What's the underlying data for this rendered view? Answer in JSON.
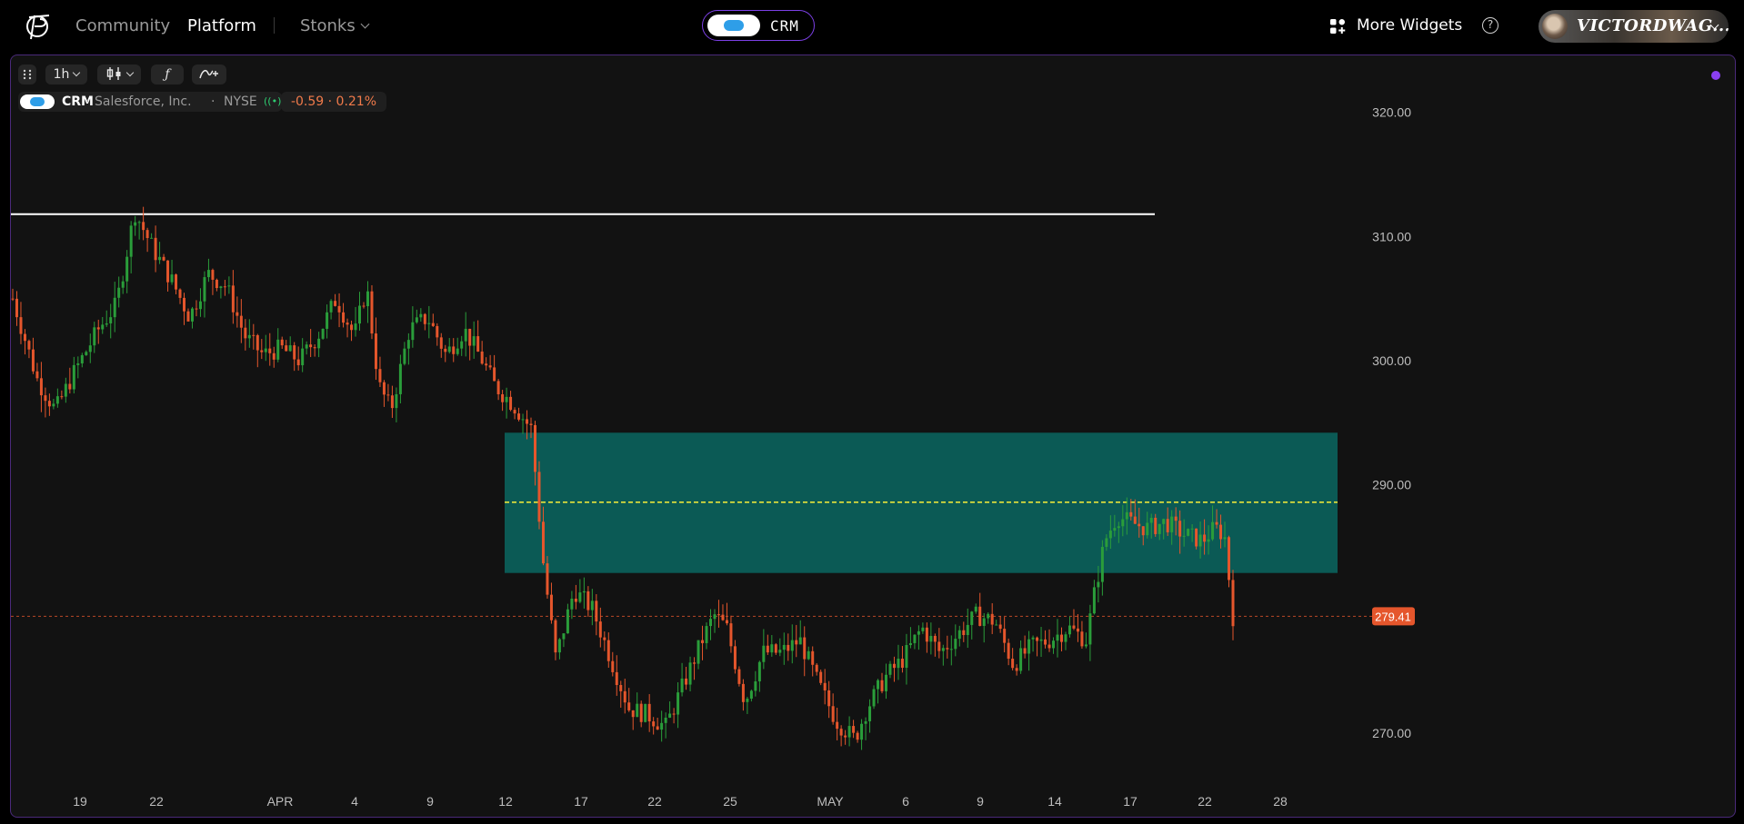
{
  "nav": {
    "community": "Community",
    "platform": "Platform",
    "stonks": "Stonks",
    "ticker": "CRM",
    "more_widgets": "More Widgets",
    "help": "?",
    "username": "VICTORDWAG..."
  },
  "toolbar": {
    "interval": "1h",
    "chart_type": "candles",
    "indicators": "f",
    "drawing": "draw"
  },
  "legend": {
    "symbol": "CRM",
    "name": "Salesforce, Inc.",
    "exchange": "NYSE",
    "change": "-0.59 · 0.21%",
    "sep": "·"
  },
  "colors": {
    "up": "#2a9d3a",
    "down": "#e5562c",
    "zone": "#0b5a55",
    "accent": "#7b3fe4",
    "last_price": "#e5562c"
  },
  "chart_data": {
    "type": "candlestick",
    "interval": "1h",
    "ylim": [
      264,
      324
    ],
    "y_ticks": [
      "320.00",
      "310.00",
      "300.00",
      "290.00",
      "270.00"
    ],
    "x_ticks": [
      "19",
      "22",
      "APR",
      "4",
      "9",
      "12",
      "17",
      "22",
      "25",
      "MAY",
      "6",
      "9",
      "14",
      "17",
      "22",
      "28"
    ],
    "last_price": "279.41",
    "last_price_value": 279.41,
    "resistance_line": 311.8,
    "zone": {
      "top": 294.2,
      "bottom": 282.9
    },
    "zone_midline": 288.6,
    "path_points": [
      [
        0,
        305.0
      ],
      [
        0.02,
        298.5
      ],
      [
        0.035,
        296.0
      ],
      [
        0.05,
        299.0
      ],
      [
        0.07,
        302.5
      ],
      [
        0.085,
        304.5
      ],
      [
        0.1,
        312.0
      ],
      [
        0.115,
        309.0
      ],
      [
        0.13,
        306.5
      ],
      [
        0.145,
        303.5
      ],
      [
        0.16,
        307.0
      ],
      [
        0.175,
        306.0
      ],
      [
        0.19,
        302.0
      ],
      [
        0.205,
        300.5
      ],
      [
        0.22,
        301.0
      ],
      [
        0.235,
        300.0
      ],
      [
        0.25,
        302.0
      ],
      [
        0.265,
        305.0
      ],
      [
        0.28,
        302.0
      ],
      [
        0.29,
        306.0
      ],
      [
        0.3,
        298.0
      ],
      [
        0.31,
        296.0
      ],
      [
        0.325,
        302.5
      ],
      [
        0.34,
        303.5
      ],
      [
        0.355,
        300.5
      ],
      [
        0.37,
        302.5
      ],
      [
        0.385,
        300.0
      ],
      [
        0.395,
        298.0
      ],
      [
        0.41,
        296.5
      ],
      [
        0.425,
        294.5
      ],
      [
        0.435,
        283.5
      ],
      [
        0.445,
        276.0
      ],
      [
        0.46,
        281.5
      ],
      [
        0.475,
        280.0
      ],
      [
        0.49,
        276.0
      ],
      [
        0.505,
        272.0
      ],
      [
        0.52,
        271.5
      ],
      [
        0.535,
        270.5
      ],
      [
        0.55,
        274.0
      ],
      [
        0.565,
        277.5
      ],
      [
        0.575,
        279.5
      ],
      [
        0.585,
        278.5
      ],
      [
        0.6,
        272.5
      ],
      [
        0.615,
        276.5
      ],
      [
        0.63,
        276.5
      ],
      [
        0.645,
        277.5
      ],
      [
        0.66,
        274.0
      ],
      [
        0.675,
        271.0
      ],
      [
        0.69,
        269.5
      ],
      [
        0.7,
        272.0
      ],
      [
        0.715,
        274.5
      ],
      [
        0.73,
        276.0
      ],
      [
        0.745,
        278.5
      ],
      [
        0.76,
        276.5
      ],
      [
        0.775,
        278.0
      ],
      [
        0.79,
        279.5
      ],
      [
        0.805,
        279.0
      ],
      [
        0.82,
        275.5
      ],
      [
        0.835,
        277.0
      ],
      [
        0.85,
        277.5
      ],
      [
        0.865,
        278.5
      ],
      [
        0.88,
        277.5
      ],
      [
        0.885,
        280.5
      ],
      [
        0.895,
        285.5
      ],
      [
        0.905,
        287.5
      ],
      [
        0.915,
        287.0
      ],
      [
        0.93,
        286.5
      ],
      [
        0.945,
        287.0
      ],
      [
        0.96,
        286.0
      ],
      [
        0.975,
        285.5
      ],
      [
        0.985,
        286.5
      ],
      [
        0.993,
        286.0
      ],
      [
        1.0,
        279.4
      ]
    ]
  }
}
